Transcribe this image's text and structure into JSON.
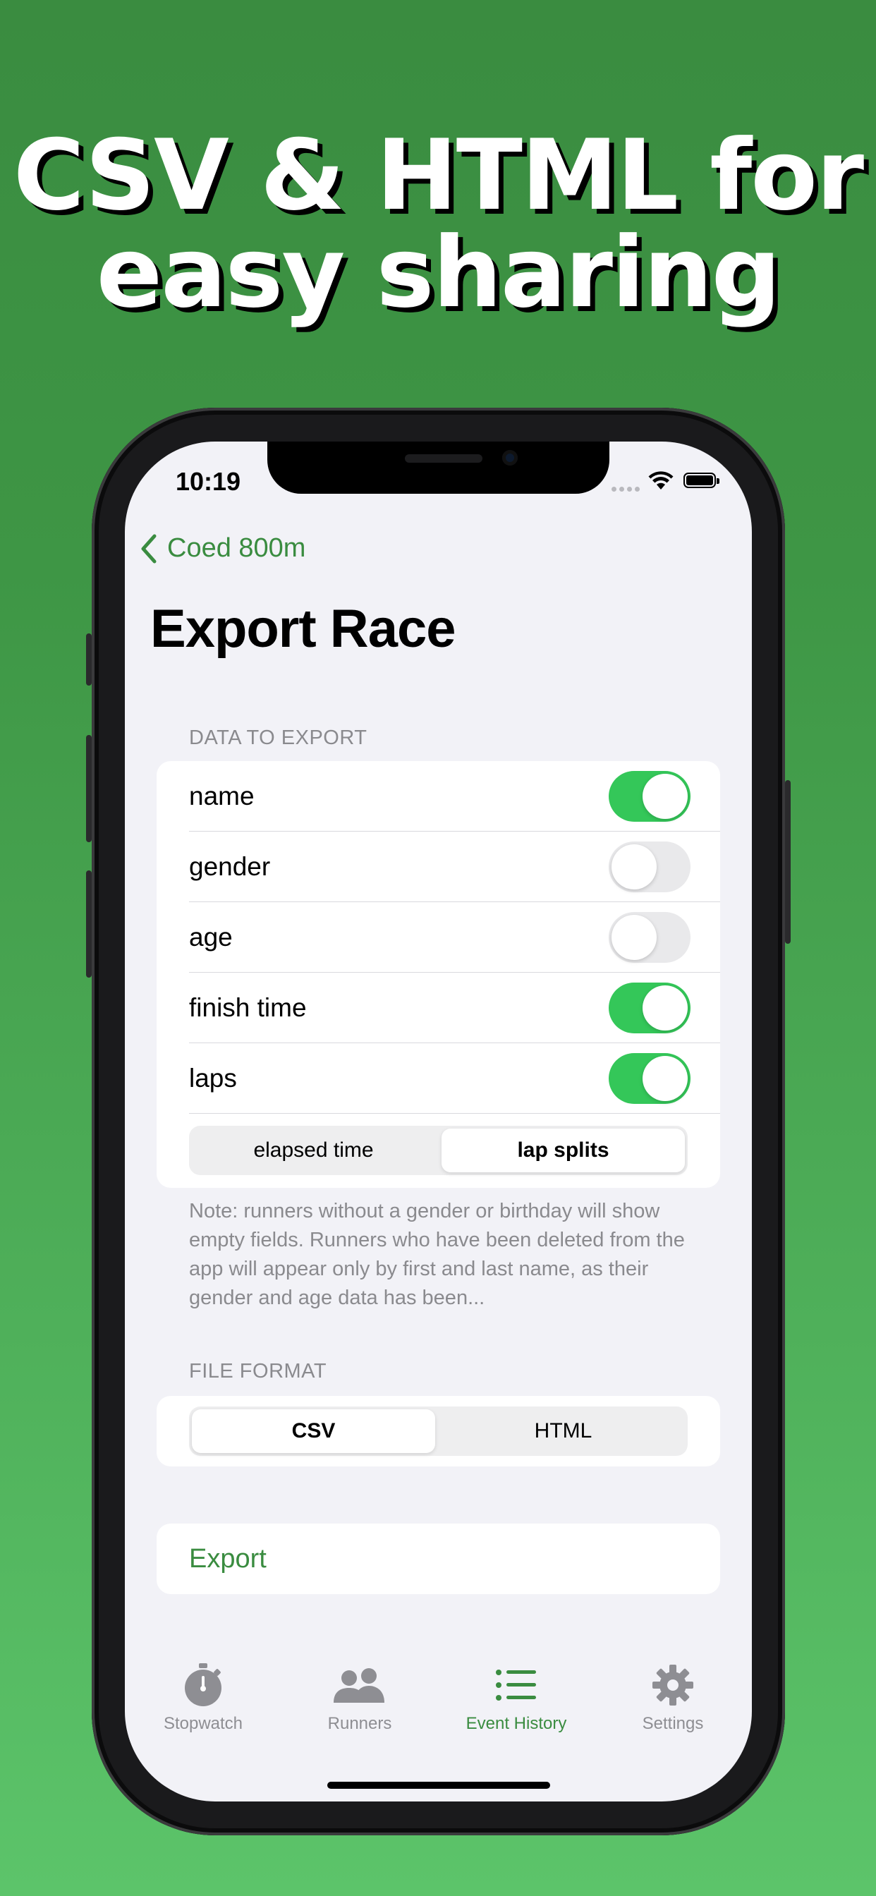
{
  "headline": {
    "line1": "CSV & HTML for",
    "line2": "easy sharing"
  },
  "status_bar": {
    "time": "10:19"
  },
  "nav": {
    "back_label": "Coed 800m",
    "title": "Export Race"
  },
  "data_section": {
    "header": "DATA TO EXPORT",
    "fields": [
      {
        "label": "name",
        "on": true
      },
      {
        "label": "gender",
        "on": false
      },
      {
        "label": "age",
        "on": false
      },
      {
        "label": "finish time",
        "on": true
      },
      {
        "label": "laps",
        "on": true
      }
    ],
    "lap_mode": {
      "options": [
        "elapsed time",
        "lap splits"
      ],
      "selected": "lap splits"
    },
    "note": "Note: runners without a gender or birthday will show empty fields. Runners who have been deleted from the app will appear only by first and last name, as their gender and age data has been..."
  },
  "format_section": {
    "header": "FILE FORMAT",
    "options": [
      "CSV",
      "HTML"
    ],
    "selected": "CSV"
  },
  "export_label": "Export",
  "tab_bar": {
    "tabs": [
      {
        "label": "Stopwatch",
        "icon": "stopwatch-icon"
      },
      {
        "label": "Runners",
        "icon": "people-icon"
      },
      {
        "label": "Event History",
        "icon": "list-icon",
        "active": true
      },
      {
        "label": "Settings",
        "icon": "gear-icon"
      }
    ]
  },
  "colors": {
    "accent": "#3a8c40",
    "toggle_on": "#34c759",
    "background_top": "#3a8c40",
    "background_bottom": "#5cc46a"
  }
}
